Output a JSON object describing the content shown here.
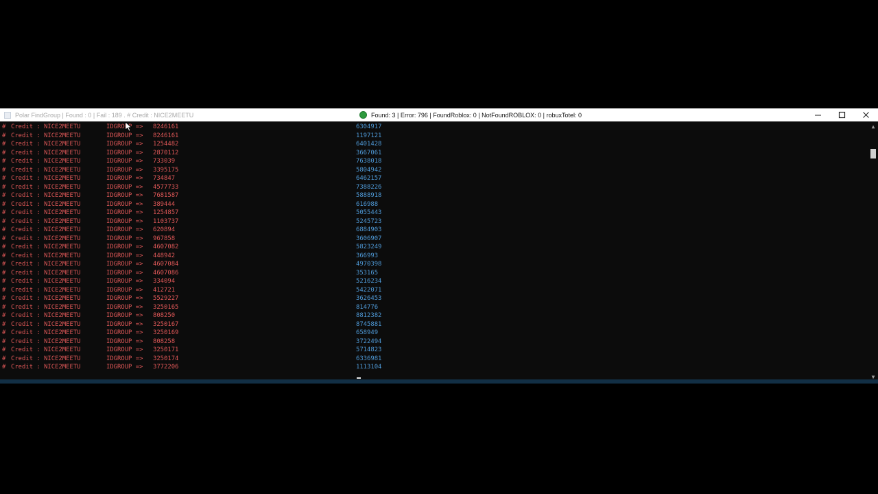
{
  "left_window": {
    "title": "Polar FindGroup | Found : 0 | Fail : 189 . # Credit : NICE2MEETU",
    "icon": "console-icon"
  },
  "right_window": {
    "title": "Found: 3 | Error: 796 | FoundRoblox: 0 | NotFoundROBLOX: 0 | robuxTotel: 0",
    "icon": "green-circle-icon",
    "controls": {
      "minimize": "—",
      "maximize": "☐",
      "close": "✕"
    }
  },
  "left_log": [
    {
      "hash": "#",
      "credit": "Credit : NICE2MEETU",
      "label": "IDGROUP => ",
      "id": "8246161"
    },
    {
      "hash": "#",
      "credit": "Credit : NICE2MEETU",
      "label": "IDGROUP => ",
      "id": "8246161"
    },
    {
      "hash": "#",
      "credit": "Credit : NICE2MEETU",
      "label": "IDGROUP => ",
      "id": "1254482"
    },
    {
      "hash": "#",
      "credit": "Credit : NICE2MEETU",
      "label": "IDGROUP => ",
      "id": "2870112"
    },
    {
      "hash": "#",
      "credit": "Credit : NICE2MEETU",
      "label": "IDGROUP => ",
      "id": "733039"
    },
    {
      "hash": "#",
      "credit": "Credit : NICE2MEETU",
      "label": "IDGROUP => ",
      "id": "3395175"
    },
    {
      "hash": "#",
      "credit": "Credit : NICE2MEETU",
      "label": "IDGROUP => ",
      "id": "734847"
    },
    {
      "hash": "#",
      "credit": "Credit : NICE2MEETU",
      "label": "IDGROUP => ",
      "id": "4577733"
    },
    {
      "hash": "#",
      "credit": "Credit : NICE2MEETU",
      "label": "IDGROUP => ",
      "id": "7681587"
    },
    {
      "hash": "#",
      "credit": "Credit : NICE2MEETU",
      "label": "IDGROUP => ",
      "id": "389444"
    },
    {
      "hash": "#",
      "credit": "Credit : NICE2MEETU",
      "label": "IDGROUP => ",
      "id": "1254857"
    },
    {
      "hash": "#",
      "credit": "Credit : NICE2MEETU",
      "label": "IDGROUP => ",
      "id": "1103737"
    },
    {
      "hash": "#",
      "credit": "Credit : NICE2MEETU",
      "label": "IDGROUP => ",
      "id": "620894"
    },
    {
      "hash": "#",
      "credit": "Credit : NICE2MEETU",
      "label": "IDGROUP => ",
      "id": "967858"
    },
    {
      "hash": "#",
      "credit": "Credit : NICE2MEETU",
      "label": "IDGROUP => ",
      "id": "4607082"
    },
    {
      "hash": "#",
      "credit": "Credit : NICE2MEETU",
      "label": "IDGROUP => ",
      "id": "448942"
    },
    {
      "hash": "#",
      "credit": "Credit : NICE2MEETU",
      "label": "IDGROUP => ",
      "id": "4607084"
    },
    {
      "hash": "#",
      "credit": "Credit : NICE2MEETU",
      "label": "IDGROUP => ",
      "id": "4607086"
    },
    {
      "hash": "#",
      "credit": "Credit : NICE2MEETU",
      "label": "IDGROUP => ",
      "id": "334094"
    },
    {
      "hash": "#",
      "credit": "Credit : NICE2MEETU",
      "label": "IDGROUP => ",
      "id": "412721"
    },
    {
      "hash": "#",
      "credit": "Credit : NICE2MEETU",
      "label": "IDGROUP => ",
      "id": "5529227"
    },
    {
      "hash": "#",
      "credit": "Credit : NICE2MEETU",
      "label": "IDGROUP => ",
      "id": "3250165"
    },
    {
      "hash": "#",
      "credit": "Credit : NICE2MEETU",
      "label": "IDGROUP => ",
      "id": "808250"
    },
    {
      "hash": "#",
      "credit": "Credit : NICE2MEETU",
      "label": "IDGROUP => ",
      "id": "3250167"
    },
    {
      "hash": "#",
      "credit": "Credit : NICE2MEETU",
      "label": "IDGROUP => ",
      "id": "3250169"
    },
    {
      "hash": "#",
      "credit": "Credit : NICE2MEETU",
      "label": "IDGROUP => ",
      "id": "808258"
    },
    {
      "hash": "#",
      "credit": "Credit : NICE2MEETU",
      "label": "IDGROUP => ",
      "id": "3250171"
    },
    {
      "hash": "#",
      "credit": "Credit : NICE2MEETU",
      "label": "IDGROUP => ",
      "id": "3250174"
    },
    {
      "hash": "#",
      "credit": "Credit : NICE2MEETU",
      "label": "IDGROUP => ",
      "id": "3772206"
    }
  ],
  "right_log": [
    "6304917",
    "1197121",
    "6401428",
    "3667061",
    "7638018",
    "5804942",
    "6462157",
    "7388226",
    "5888918",
    "616988",
    "5055443",
    "5245723",
    "6884903",
    "3606907",
    "5823249",
    "366993",
    "4970398",
    "353165",
    "5216234",
    "5422071",
    "3626453",
    "814776",
    "8812382",
    "8745881",
    "658949",
    "3722494",
    "5714823",
    "6336981",
    "1113104"
  ],
  "colors": {
    "log_red": "#e05858",
    "log_blue": "#4f9ad8",
    "console_bg": "#0c0c0c"
  }
}
